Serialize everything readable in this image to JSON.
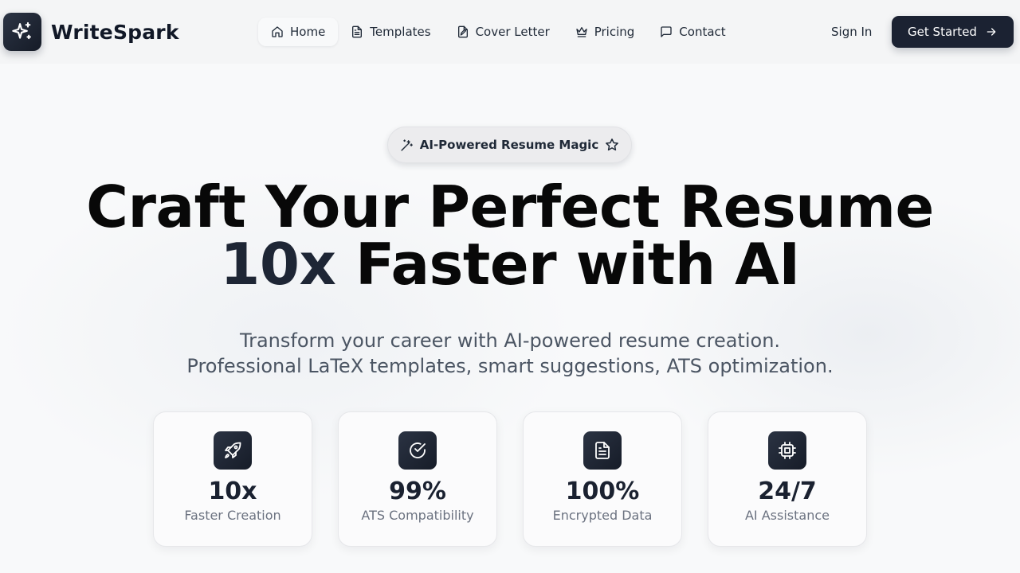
{
  "brand": {
    "name": "WriteSpark",
    "icon": "sparkles-icon"
  },
  "nav": {
    "items": [
      {
        "label": "Home",
        "icon": "home-icon",
        "active": true
      },
      {
        "label": "Templates",
        "icon": "document-icon",
        "active": false
      },
      {
        "label": "Cover Letter",
        "icon": "file-signature-icon",
        "active": false
      },
      {
        "label": "Pricing",
        "icon": "crown-icon",
        "active": false
      },
      {
        "label": "Contact",
        "icon": "message-square-icon",
        "active": false
      }
    ],
    "signin_label": "Sign In",
    "cta_label": "Get Started",
    "cta_icon": "arrow-right-icon"
  },
  "hero": {
    "badge_label": "AI-Powered Resume Magic",
    "badge_icons": [
      "wand-sparkles-icon",
      "star-icon"
    ],
    "headline_line1": "Craft Your Perfect Resume",
    "headline_accent": "10x",
    "headline_line2_rest": " Faster with AI",
    "subtitle_line1": "Transform your career with AI-powered resume creation.",
    "subtitle_line2": "Professional LaTeX templates, smart suggestions, ATS optimization."
  },
  "stats": [
    {
      "value": "10x",
      "label": "Faster Creation",
      "icon": "rocket-icon"
    },
    {
      "value": "99%",
      "label": "ATS Compatibility",
      "icon": "check-circle-icon"
    },
    {
      "value": "100%",
      "label": "Encrypted Data",
      "icon": "file-text-icon"
    },
    {
      "value": "24/7",
      "label": "AI Assistance",
      "icon": "cpu-icon"
    }
  ],
  "colors": {
    "brand_dark": "#1b2232",
    "headline": "#080808",
    "accent_text": "#1e2635",
    "muted_text": "#6b7280",
    "background": "#f8f9fa"
  }
}
